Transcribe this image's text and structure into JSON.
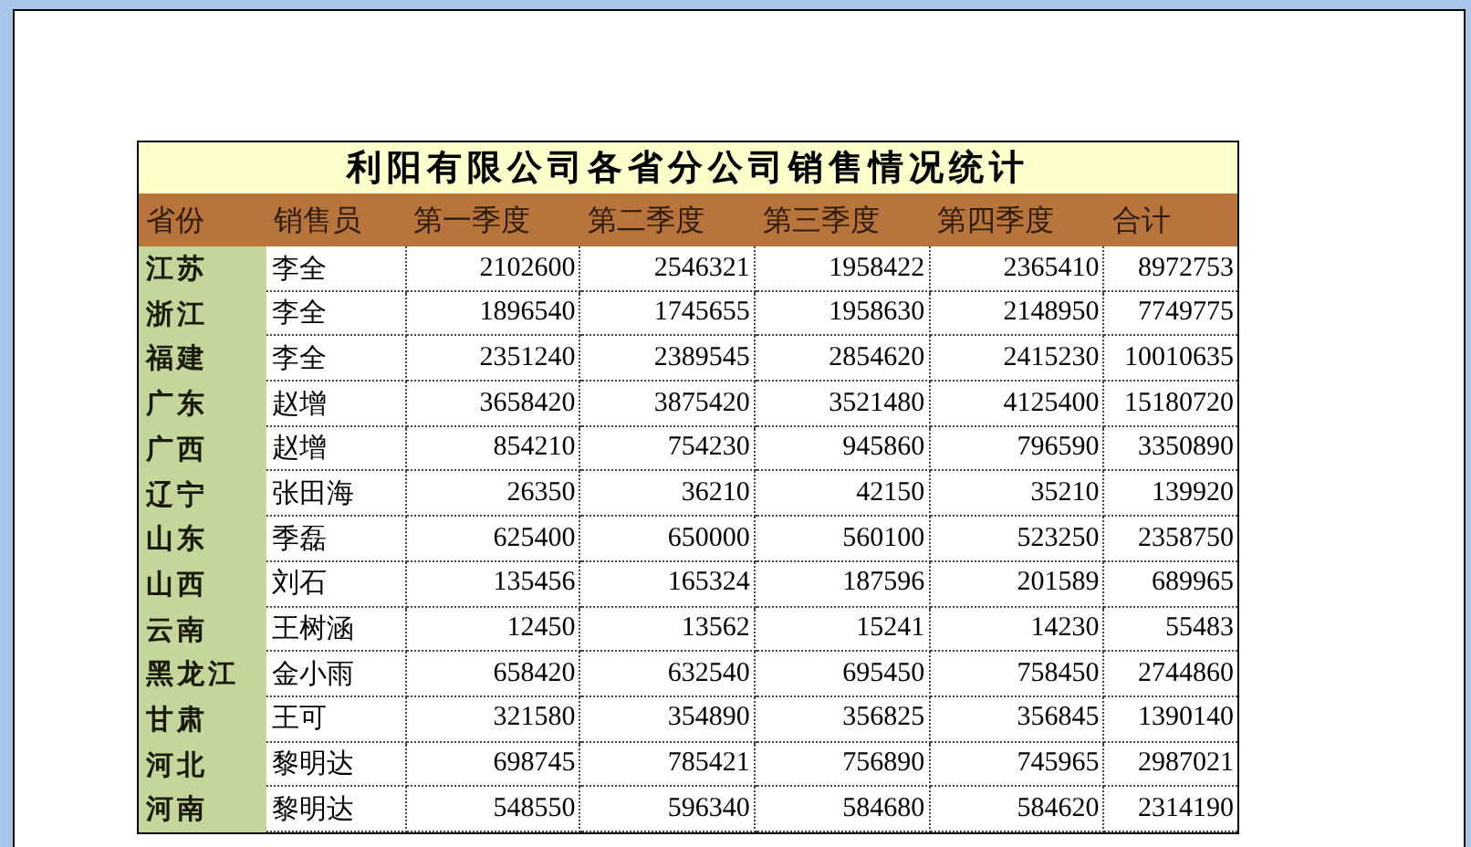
{
  "table": {
    "title": "利阳有限公司各省分公司销售情况统计",
    "columns": [
      "省份",
      "销售员",
      "第一季度",
      "第二季度",
      "第三季度",
      "第四季度",
      "合计"
    ],
    "rows": [
      {
        "cells": [
          "江苏",
          "李全",
          "2102600",
          "2546321",
          "1958422",
          "2365410",
          "8972753"
        ]
      },
      {
        "cells": [
          "浙江",
          "李全",
          "1896540",
          "1745655",
          "1958630",
          "2148950",
          "7749775"
        ]
      },
      {
        "cells": [
          "福建",
          "李全",
          "2351240",
          "2389545",
          "2854620",
          "2415230",
          "10010635"
        ]
      },
      {
        "cells": [
          "广东",
          "赵增",
          "3658420",
          "3875420",
          "3521480",
          "4125400",
          "15180720"
        ]
      },
      {
        "cells": [
          "广西",
          "赵增",
          "854210",
          "754230",
          "945860",
          "796590",
          "3350890"
        ]
      },
      {
        "cells": [
          "辽宁",
          "张田海",
          "26350",
          "36210",
          "42150",
          "35210",
          "139920"
        ]
      },
      {
        "cells": [
          "山东",
          "季磊",
          "625400",
          "650000",
          "560100",
          "523250",
          "2358750"
        ]
      },
      {
        "cells": [
          "山西",
          "刘石",
          "135456",
          "165324",
          "187596",
          "201589",
          "689965"
        ]
      },
      {
        "cells": [
          "云南",
          "王树涵",
          "12450",
          "13562",
          "15241",
          "14230",
          "55483"
        ]
      },
      {
        "cells": [
          "黑龙江",
          "金小雨",
          "658420",
          "632540",
          "695450",
          "758450",
          "2744860"
        ]
      },
      {
        "cells": [
          "甘肃",
          "王可",
          "321580",
          "354890",
          "356825",
          "356845",
          "1390140"
        ]
      },
      {
        "cells": [
          "河北",
          "黎明达",
          "698745",
          "785421",
          "756890",
          "745965",
          "2987021"
        ]
      },
      {
        "cells": [
          "河南",
          "黎明达",
          "548550",
          "596340",
          "584680",
          "584620",
          "2314190"
        ]
      }
    ]
  }
}
